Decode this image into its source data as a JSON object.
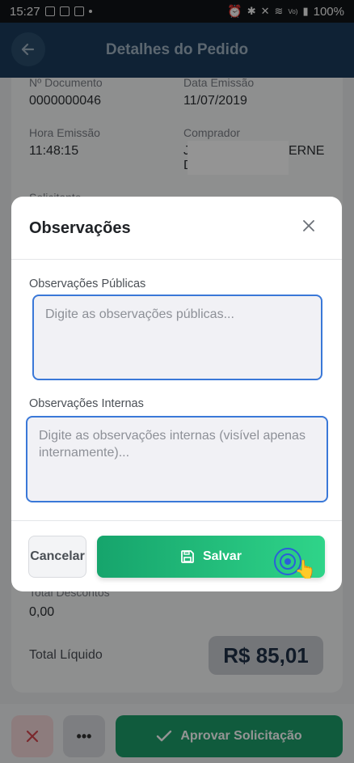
{
  "status_bar": {
    "time": "15:27",
    "battery": "100%",
    "network": "LTE1",
    "volte": "Vo)"
  },
  "header": {
    "title": "Detalhes do Pedido"
  },
  "details": {
    "documento_label": "Nº Documento",
    "documento_value": "0000000046",
    "data_label": "Data Emissão",
    "data_value": "11/07/2019",
    "hora_label": "Hora Emissão",
    "hora_value": "11:48:15",
    "comprador_label": "Comprador",
    "comprador_value_line1": "J",
    "comprador_value_suffix": "ERNE",
    "comprador_value_line2": "D",
    "solicitante_label": "Solicitante",
    "descontos_label": "Total Descontos",
    "descontos_value": "0,00",
    "liquido_label": "Total Líquido",
    "liquido_value": "R$ 85,01"
  },
  "modal": {
    "title": "Observações",
    "publicas_label": "Observações Públicas",
    "publicas_placeholder": "Digite as observações públicas...",
    "publicas_value": "",
    "internas_label": "Observações Internas",
    "internas_placeholder": "Digite as observações internas (visível apenas internamente)...",
    "internas_value": "",
    "cancel_label": "Cancelar",
    "save_label": "Salvar"
  },
  "bottom_bar": {
    "approve_label": "Aprovar Solicitação"
  },
  "colors": {
    "header": "#1a3c5c",
    "primary_green": "#1c9e6a",
    "focus_blue": "#3a78d8",
    "danger": "#d4474f"
  },
  "icons": [
    "back-arrow-icon",
    "close-icon",
    "save-icon",
    "check-icon",
    "x-icon",
    "more-icon",
    "tap-indicator-icon"
  ]
}
